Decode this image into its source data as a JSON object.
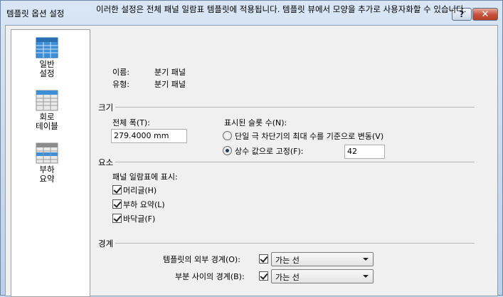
{
  "window": {
    "title": "템플릿 옵션 설정",
    "help_label": "?",
    "close_label": "✕"
  },
  "sidebar": {
    "items": [
      {
        "label": "일반 설정",
        "icon": "table-icon",
        "selected": true
      },
      {
        "label": "회로 테이블",
        "icon": "table-icon",
        "selected": false
      },
      {
        "label": "부하 요약",
        "icon": "table-icon",
        "selected": false
      }
    ]
  },
  "description": "이러한 설정은 전체 패널 일람표 템플릿에 적용됩니다. 템플릿 뷰에서 모양을 추가로 사용자화할 수 있습니다.",
  "info": {
    "name_label": "이름:",
    "name_value": "분기 패널",
    "type_label": "유형:",
    "type_value": "분기 패널"
  },
  "size": {
    "section_title": "크기",
    "total_width_label": "전체 폭(T):",
    "total_width_value": "279.4000 mm",
    "slots_label": "표시된 슬롯 수(N):",
    "option_variable_label": "단일 극 차단기의 최대 수를 기준으로 변동(V)",
    "option_fixed_label": "상수 값으로 고정(F):",
    "fixed_value": "42",
    "selected_option": "fixed"
  },
  "elements": {
    "section_title": "요소",
    "show_label": "패널 일람표에 표시:",
    "items": [
      {
        "label": "머리글(H)",
        "checked": true
      },
      {
        "label": "부하 요약(L)",
        "checked": true
      },
      {
        "label": "바닥글(F)",
        "checked": true
      }
    ]
  },
  "borders": {
    "section_title": "경계",
    "outer_label": "템플릿의 외부 경계(O):",
    "outer_checked": true,
    "outer_value": "가는 선",
    "between_label": "부분 사이의 경계(B):",
    "between_checked": true,
    "between_value": "가는 선"
  }
}
